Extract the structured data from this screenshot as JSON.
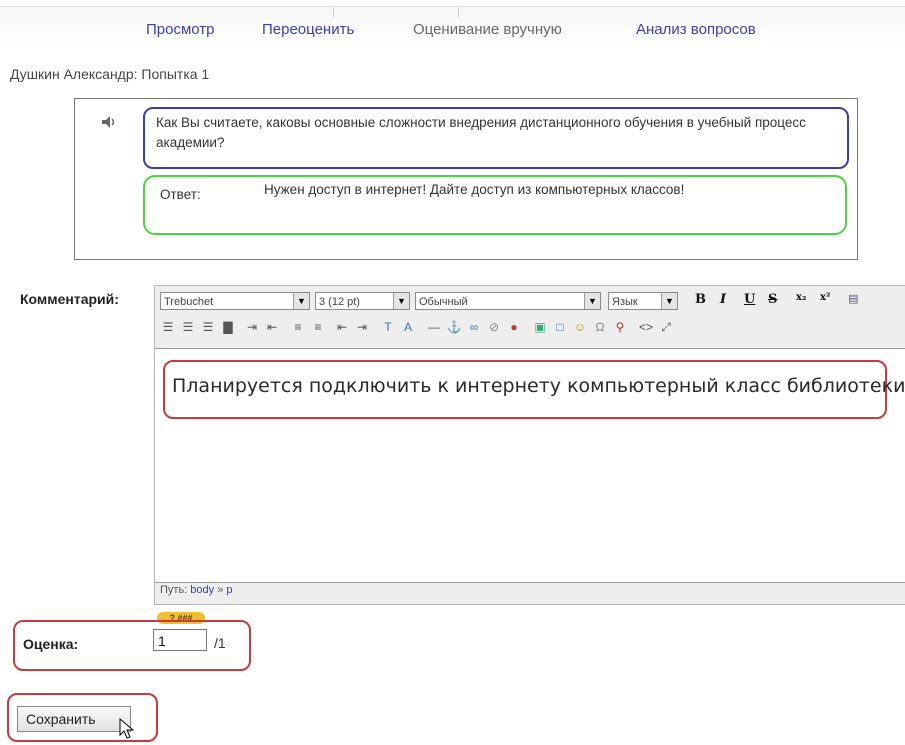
{
  "tabs": [
    {
      "label": "Просмотр",
      "active": false
    },
    {
      "label": "Переоценить",
      "active": false
    },
    {
      "label": "Оценивание вручную",
      "active": true
    },
    {
      "label": "Анализ вопросов",
      "active": false
    }
  ],
  "attempt": "Душкин Александр: Попытка 1",
  "question": {
    "icon": "sound-icon",
    "text": "Как Вы считаете, каковы основные сложности внедрения дистанционного обучения в учебный процесс академии?",
    "answer_label": "Ответ:",
    "answer_text": "Нужен доступ в интернет! Дайте доступ из компьютерных классов!"
  },
  "comment": {
    "label": "Комментарий:",
    "font": "Trebuchet",
    "size": "3 (12 pt)",
    "format": "Обычный",
    "language": "Язык",
    "text": "Планируется подключить к интернету компьютерный класс библиотеки.",
    "path_label": "Путь:",
    "path_body": "body",
    "path_sep": "»",
    "path_p": "p",
    "help_badge": "? ###"
  },
  "grade": {
    "label": "Оценка:",
    "value": "1",
    "max": "/1"
  },
  "save_label": "Сохранить",
  "colors": {
    "link": "#3b3db8",
    "question_border": "#3b3bb8",
    "answer_border": "#49d63d",
    "highlight_border": "#c83b3b"
  }
}
